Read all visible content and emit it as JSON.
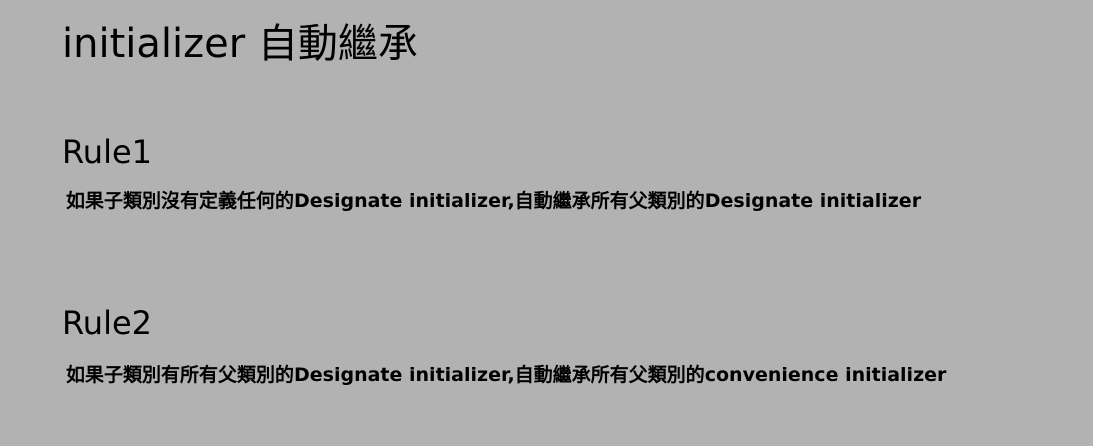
{
  "slide": {
    "background_color": "#b2b2b2",
    "text_color": "#000000",
    "title": "initializer 自動繼承",
    "rules": [
      {
        "heading": "Rule1",
        "text": "如果子類別沒有定義任何的Designate initializer,自動繼承所有父類別的Designate initializer"
      },
      {
        "heading": "Rule2",
        "text": "如果子類別有所有父類別的Designate initializer,自動繼承所有父類別的convenience initializer"
      }
    ]
  }
}
